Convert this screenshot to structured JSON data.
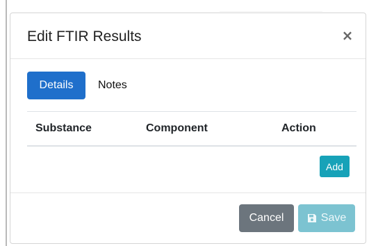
{
  "modal": {
    "title": "Edit FTIR Results",
    "close_symbol": "×"
  },
  "tabs": [
    {
      "label": "Details",
      "active": true
    },
    {
      "label": "Notes",
      "active": false
    }
  ],
  "table": {
    "columns": [
      "Substance",
      "Component",
      "Action"
    ],
    "rows": []
  },
  "buttons": {
    "add_label": "Add",
    "cancel_label": "Cancel",
    "save_label": "Save",
    "save_disabled": true
  },
  "icons": {
    "close": "close-icon",
    "save": "floppy-disk-icon"
  },
  "colors": {
    "primary": "#1f6fcb",
    "info": "#17a2b8",
    "secondary": "#6c757d",
    "info_disabled": "#7cc3d1"
  }
}
